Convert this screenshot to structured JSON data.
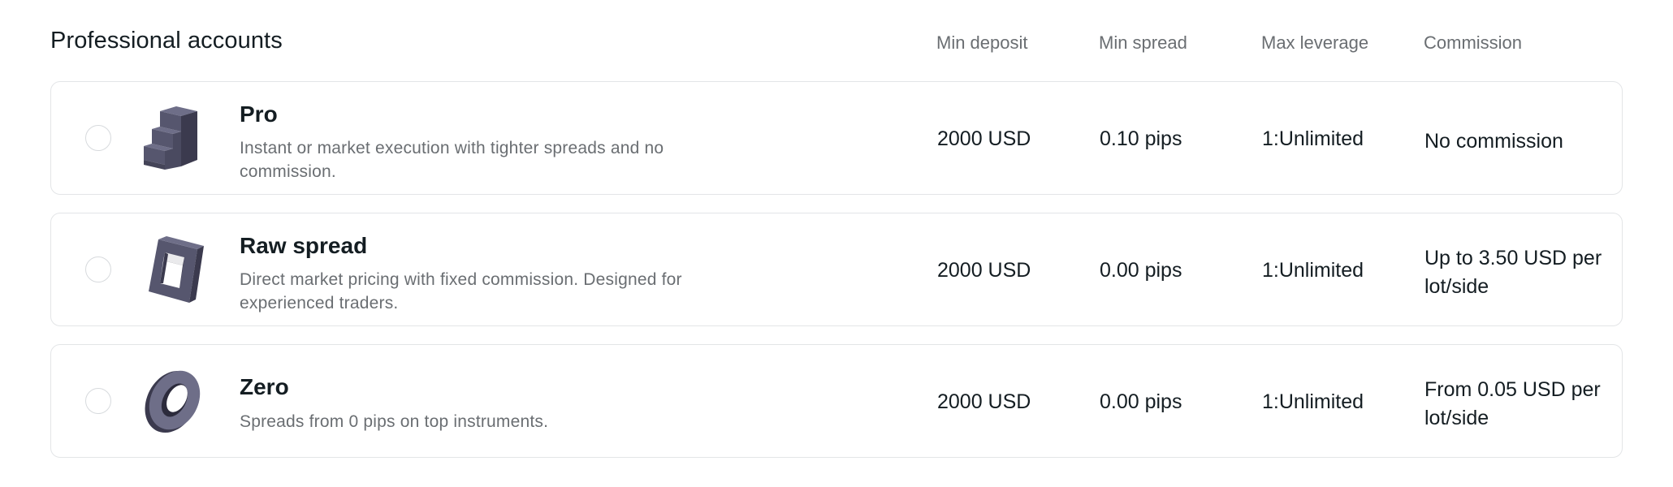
{
  "section": {
    "title": "Professional accounts"
  },
  "columns": {
    "min_deposit": "Min deposit",
    "min_spread": "Min spread",
    "max_leverage": "Max leverage",
    "commission": "Commission"
  },
  "accounts": [
    {
      "name": "Pro",
      "description": "Instant or market execution with tighter spreads and no commission.",
      "icon": "stairs-icon",
      "min_deposit": "2000 USD",
      "min_spread": "0.10 pips",
      "max_leverage": "1:Unlimited",
      "commission": "No commission",
      "selected": false
    },
    {
      "name": "Raw spread",
      "description": "Direct market pricing with fixed commission. Designed for experienced traders.",
      "icon": "square-frame-icon",
      "min_deposit": "2000 USD",
      "min_spread": "0.00 pips",
      "max_leverage": "1:Unlimited",
      "commission": "Up to 3.50 USD per lot/side",
      "selected": false
    },
    {
      "name": "Zero",
      "description": "Spreads from 0 pips on top instruments.",
      "icon": "ring-icon",
      "min_deposit": "2000 USD",
      "min_spread": "0.00 pips",
      "max_leverage": "1:Unlimited",
      "commission": "From 0.05 USD per lot/side",
      "selected": false
    }
  ],
  "colors": {
    "icon_dark": "#3b3a4e",
    "icon_mid": "#56566e",
    "icon_light": "#6e6e88",
    "border": "#e3e5e7",
    "muted_text": "#6a6e72"
  }
}
